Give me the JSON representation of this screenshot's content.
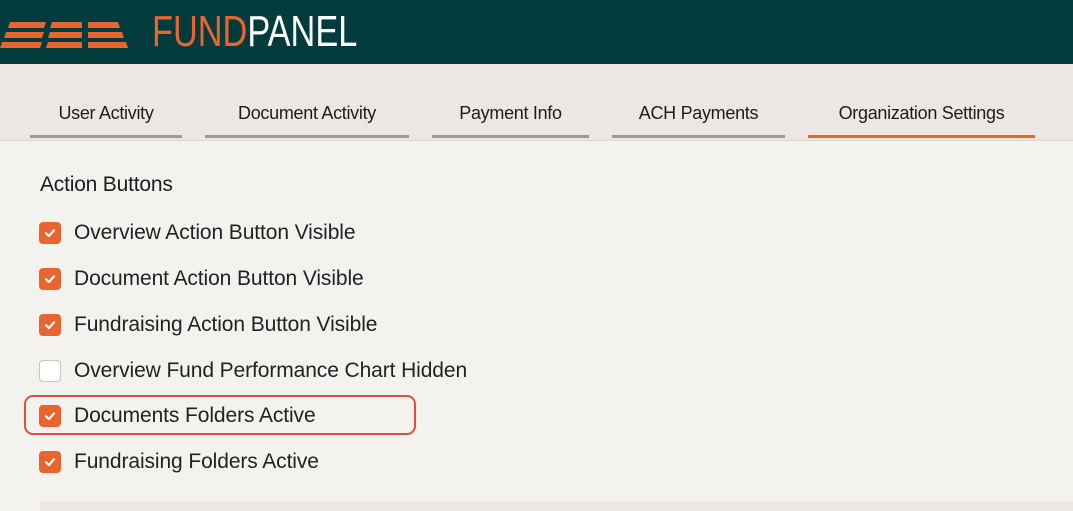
{
  "brand": {
    "name_part1": "FUND",
    "name_part2": "PANEL",
    "accent_color": "#e8652f",
    "header_color": "#043b3d"
  },
  "tabs": [
    {
      "label": "User Activity",
      "active": false
    },
    {
      "label": "Document Activity",
      "active": false
    },
    {
      "label": "Payment Info",
      "active": false
    },
    {
      "label": "ACH Payments",
      "active": false
    },
    {
      "label": "Organization Settings",
      "active": true
    }
  ],
  "section": {
    "title": "Action Buttons",
    "options": [
      {
        "label": "Overview Action Button Visible",
        "checked": true
      },
      {
        "label": "Document Action Button Visible",
        "checked": true
      },
      {
        "label": "Fundraising Action Button Visible",
        "checked": true
      },
      {
        "label": "Overview Fund Performance Chart Hidden",
        "checked": false
      },
      {
        "label": "Documents Folders Active",
        "checked": true,
        "highlighted": true
      },
      {
        "label": "Fundraising Folders Active",
        "checked": true
      }
    ]
  }
}
